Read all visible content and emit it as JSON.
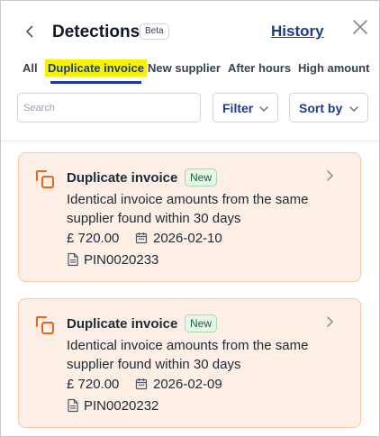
{
  "header": {
    "title": "Detections",
    "beta_label": "Beta",
    "history_label": "History"
  },
  "tabs": [
    {
      "label": "All",
      "active": false
    },
    {
      "label": "Duplicate invoice",
      "active": true
    },
    {
      "label": "New supplier",
      "active": false
    },
    {
      "label": "After hours",
      "active": false
    },
    {
      "label": "High amount",
      "active": false
    }
  ],
  "toolbar": {
    "search_placeholder": "Search",
    "search_value": "",
    "filter_label": "Filter",
    "sort_label": "Sort by"
  },
  "detections": [
    {
      "title": "Duplicate invoice",
      "badge": "New",
      "description": "Identical invoice amounts from the same supplier found within 30 days",
      "amount": "£ 720.00",
      "date": "2026-02-10",
      "reference": "PIN0020233"
    },
    {
      "title": "Duplicate invoice",
      "badge": "New",
      "description": "Identical invoice amounts from the same supplier found within 30 days",
      "amount": "£ 720.00",
      "date": "2026-02-09",
      "reference": "PIN0020232"
    }
  ],
  "colors": {
    "accent": "#1e3a8a",
    "highlight": "#f7f300",
    "card_background": "#fdefe6",
    "card_border": "#f4c9ad",
    "icon_orange": "#e8661b",
    "badge_green": "#166534"
  },
  "icons": {
    "back": "chevron-left-icon",
    "close": "close-icon",
    "filter_chevron": "chevron-down-icon",
    "sort_chevron": "chevron-down-icon",
    "card_type": "duplicate-icon",
    "card_open": "chevron-right-icon",
    "date": "calendar-icon",
    "reference": "document-icon"
  }
}
